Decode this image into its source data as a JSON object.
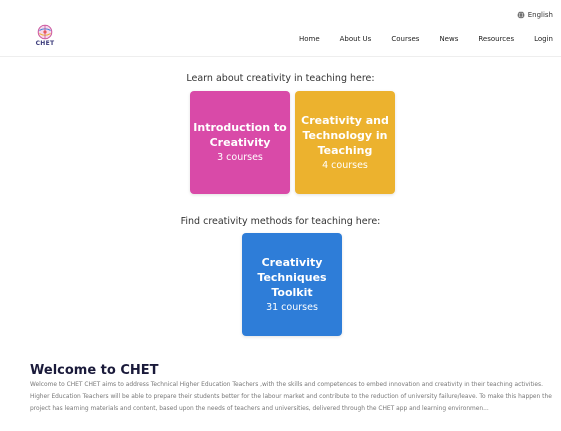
{
  "header": {
    "language": "English",
    "logo_text": "CHET",
    "nav": [
      "Home",
      "About Us",
      "Courses",
      "News",
      "Resources",
      "Login"
    ]
  },
  "section1": {
    "heading": "Learn about creativity in teaching here:",
    "cards": [
      {
        "title_lines": [
          "Introduction to",
          "Creativity"
        ],
        "count": "3 courses",
        "color": "#d94aa8"
      },
      {
        "title_lines": [
          "Creativity and",
          "Technology in",
          "Teaching"
        ],
        "count": "4 courses",
        "color": "#ecb22e"
      }
    ]
  },
  "section2": {
    "heading": "Find creativity methods for teaching here:",
    "card": {
      "title_lines": [
        "Creativity",
        "Techniques",
        "Toolkit"
      ],
      "count": "31 courses",
      "color": "#2e7dd8"
    }
  },
  "welcome": {
    "title": "Welcome to CHET",
    "text": "Welcome to CHET CHET aims to address Technical Higher Education Teachers ,with the skills and competences to embed innovation and creativity in their teaching activities. Higher Education Teachers will be able to prepare their students better for the labour market and contribute to the reduction of university failure/leave. To make this happen the project has learning materials and content, based upon the needs of teachers and universities, delivered through the CHET app and learning environmen..."
  }
}
